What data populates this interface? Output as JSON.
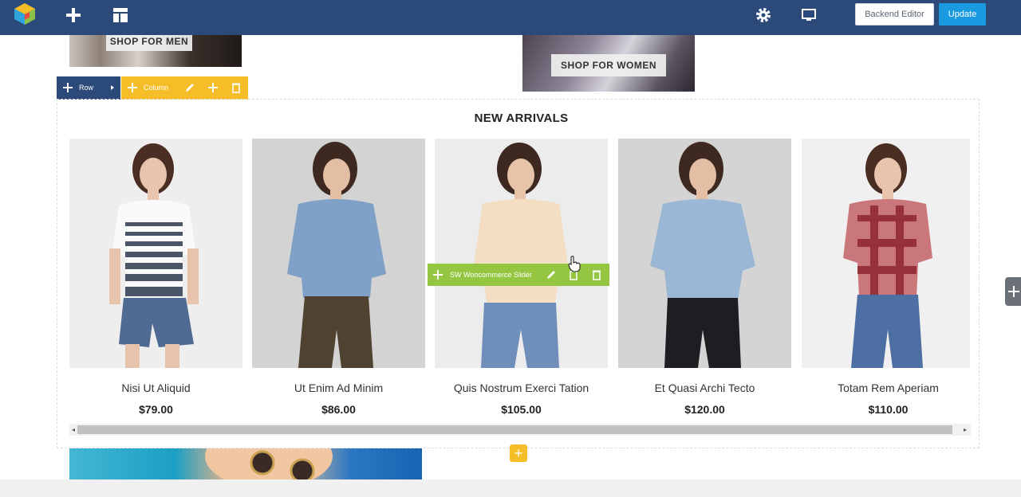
{
  "toolbar": {
    "backend_editor_label": "Backend Editor",
    "update_label": "Update"
  },
  "banners": {
    "men_label": "SHOP FOR MEN",
    "women_label": "SHOP FOR WOMEN"
  },
  "controls": {
    "row_label": "Row",
    "column_label": "Column",
    "element_label": "SW Woocommerce Slider"
  },
  "section": {
    "title": "NEW ARRIVALS"
  },
  "products": [
    {
      "name": "Nisi Ut Aliquid",
      "price": "$79.00"
    },
    {
      "name": "Ut Enim Ad Minim",
      "price": "$86.00"
    },
    {
      "name": "Quis Nostrum Exerci Tation",
      "price": "$105.00"
    },
    {
      "name": "Et Quasi Archi Tecto",
      "price": "$120.00"
    },
    {
      "name": "Totam Rem Aperiam",
      "price": "$110.00"
    }
  ],
  "colors": {
    "toolbar_bg": "#2b4a7a",
    "column_ctl": "#f5be29",
    "element_ctl": "#95c642",
    "update_button": "#1a9ae0"
  },
  "icons": [
    "logo-icon",
    "plus-icon",
    "layout-icon",
    "gear-icon",
    "monitor-icon",
    "move-icon",
    "arrow-right-icon",
    "pencil-icon",
    "copy-icon",
    "trash-icon",
    "hand-cursor-icon"
  ]
}
